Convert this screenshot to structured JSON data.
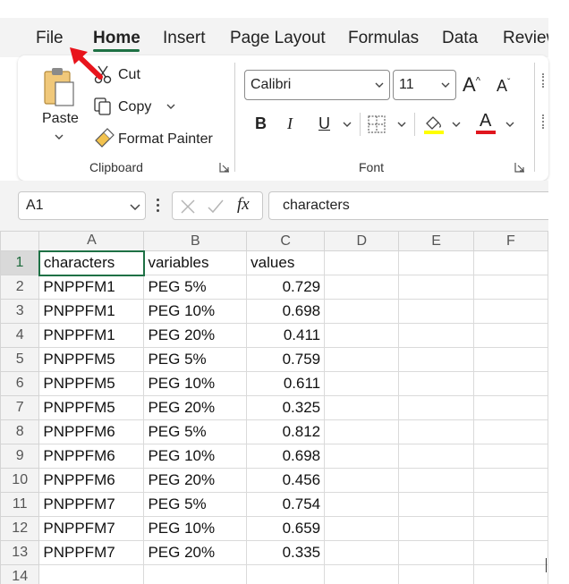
{
  "ribbon_tabs": [
    "File",
    "Home",
    "Insert",
    "Page Layout",
    "Formulas",
    "Data",
    "Review"
  ],
  "active_tab": "Home",
  "clipboard": {
    "paste_label": "Paste",
    "cut_label": "Cut",
    "copy_label": "Copy",
    "format_painter_label": "Format Painter",
    "group_label": "Clipboard"
  },
  "font": {
    "name": "Calibri",
    "size": "11",
    "group_label": "Font",
    "bold": "B",
    "italic": "I",
    "underline": "U",
    "grow_label": "A",
    "shrink_label": "A",
    "font_color_label": "A",
    "highlight_color": "#ffff00",
    "font_color": "#e0161e"
  },
  "formula_bar": {
    "name_box": "A1",
    "fx": "fx",
    "content": "characters"
  },
  "sheet": {
    "columns": [
      "A",
      "B",
      "C",
      "D",
      "E",
      "F"
    ],
    "rows": [
      {
        "n": "1",
        "a": "characters",
        "b": "variables",
        "c": "values"
      },
      {
        "n": "2",
        "a": "PNPPFM1",
        "b": "PEG 5%",
        "c": "0.729"
      },
      {
        "n": "3",
        "a": "PNPPFM1",
        "b": "PEG 10%",
        "c": "0.698"
      },
      {
        "n": "4",
        "a": "PNPPFM1",
        "b": "PEG 20%",
        "c": "0.411"
      },
      {
        "n": "5",
        "a": "PNPPFM5",
        "b": "PEG 5%",
        "c": "0.759"
      },
      {
        "n": "6",
        "a": "PNPPFM5",
        "b": "PEG 10%",
        "c": "0.611"
      },
      {
        "n": "7",
        "a": "PNPPFM5",
        "b": "PEG 20%",
        "c": "0.325"
      },
      {
        "n": "8",
        "a": "PNPPFM6",
        "b": "PEG 5%",
        "c": "0.812"
      },
      {
        "n": "9",
        "a": "PNPPFM6",
        "b": "PEG 10%",
        "c": "0.698"
      },
      {
        "n": "10",
        "a": "PNPPFM6",
        "b": "PEG 20%",
        "c": "0.456"
      },
      {
        "n": "11",
        "a": "PNPPFM7",
        "b": "PEG 5%",
        "c": "0.754"
      },
      {
        "n": "12",
        "a": "PNPPFM7",
        "b": "PEG 10%",
        "c": "0.659"
      },
      {
        "n": "13",
        "a": "PNPPFM7",
        "b": "PEG 20%",
        "c": "0.335"
      },
      {
        "n": "14",
        "a": "",
        "b": "",
        "c": ""
      }
    ]
  },
  "colors": {
    "accent_green": "#1e7145",
    "annotation_arrow": "#e8141c"
  }
}
